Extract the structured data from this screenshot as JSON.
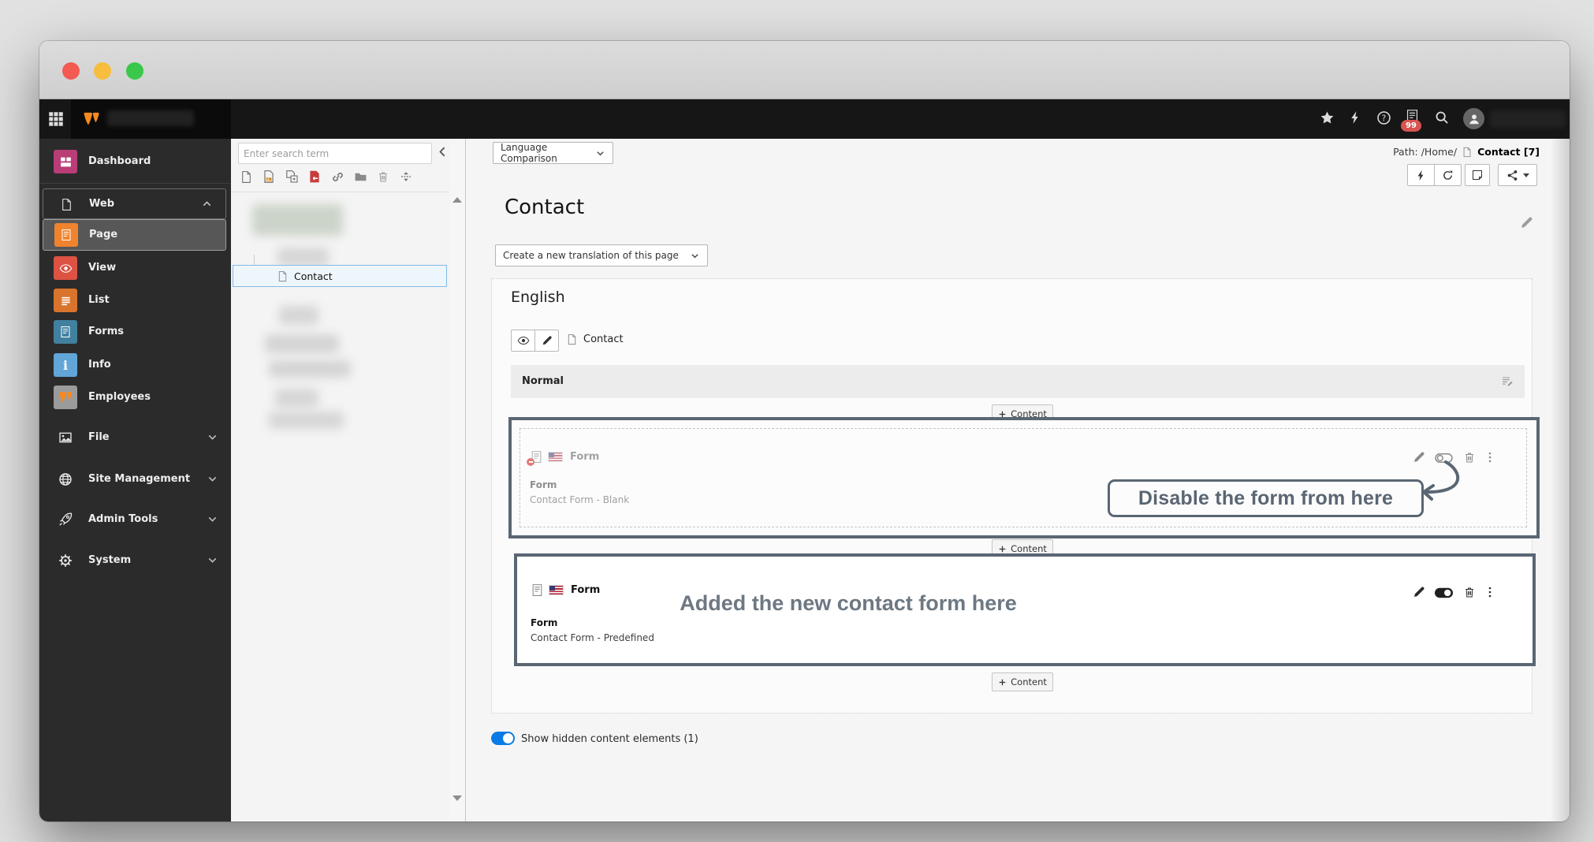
{
  "colors": {
    "accent_blue": "#0a7ae6",
    "annotation_slate": "#5a6673",
    "typo3_orange": "#f78a1e",
    "badge_red": "#d9534f"
  },
  "topbar": {
    "notification_count": "99"
  },
  "sidebar": {
    "items": [
      {
        "label": "Dashboard"
      },
      {
        "label": "Web"
      },
      {
        "label": "Page"
      },
      {
        "label": "View"
      },
      {
        "label": "List"
      },
      {
        "label": "Forms"
      },
      {
        "label": "Info"
      },
      {
        "label": "Employees"
      },
      {
        "label": "File"
      },
      {
        "label": "Site Management"
      },
      {
        "label": "Admin Tools"
      },
      {
        "label": "System"
      }
    ]
  },
  "pagetree": {
    "search_placeholder": "Enter search term",
    "selected_page": "Contact"
  },
  "docheader": {
    "language_selector": "Language Comparison",
    "path_prefix": "Path: /Home/",
    "page_reference": "Contact [7]"
  },
  "content": {
    "page_title": "Contact",
    "translation_dropdown": "Create a new translation of this page",
    "language_heading": "English",
    "page_doc_label": "Contact",
    "column_label": "Normal",
    "add_content_label": "Content",
    "elements": [
      {
        "header": "Form",
        "field_label": "Form",
        "field_value": "Contact Form - Blank"
      },
      {
        "header": "Form",
        "field_label": "Form",
        "field_value": "Contact Form - Predefined"
      }
    ],
    "annotation_disable": "Disable the form from here",
    "annotation_added": "Added the new contact form here",
    "show_hidden_label": "Show hidden content elements (1)"
  }
}
